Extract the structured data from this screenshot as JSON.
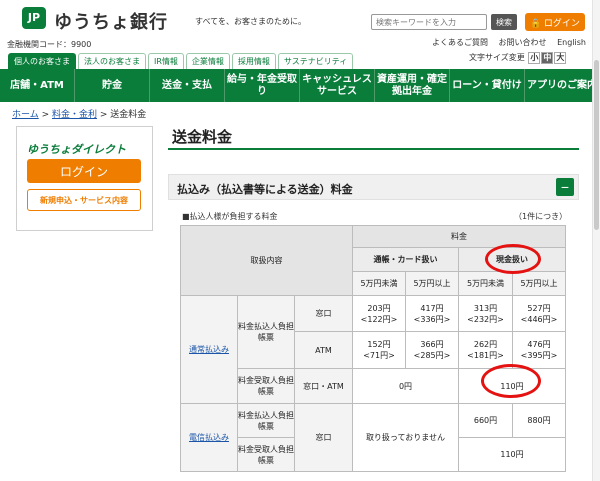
{
  "header": {
    "logo_text": "JP",
    "bank_name": "ゆうちょ銀行",
    "tagline": "すべてを、お客さまのために。",
    "search_placeholder": "検索キーワードを入力",
    "search_label": "検索",
    "login_label": "ログイン",
    "bank_code": "金融機関コード：9900",
    "utility_links": [
      "よくあるご質問",
      "お問い合わせ",
      "English"
    ],
    "font_size_label": "文字サイズ変更",
    "font_sizes": [
      "小",
      "中",
      "大"
    ]
  },
  "tabs": [
    "個人のお客さま",
    "法人のお客さま",
    "IR情報",
    "企業情報",
    "採用情報",
    "サステナビリティ"
  ],
  "main_nav": [
    "店舗・ATM",
    "貯金",
    "送金・支払",
    "給与・年金受取り",
    "キャッシュレスサービス",
    "資産運用・確定拠出年金",
    "ローン・貸付け",
    "アプリのご案内"
  ],
  "breadcrumb": [
    "ホーム",
    "料金・金利",
    "送金料金"
  ],
  "sidebar": {
    "direct_logo": "ゆうちょダイレクト",
    "login_label": "ログイン",
    "apply_label": "新規申込・サービス内容"
  },
  "page_title": "送金料金",
  "section_title": "払込み（払込書等による送金）料金",
  "table": {
    "note_left": "■払込人様が負担する料金",
    "note_right": "（1件につき）",
    "h_content": "取扱内容",
    "h_fee": "料金",
    "h_passbook": "通帳・カード扱い",
    "h_cash": "現金扱い",
    "h_under": "5万円未満",
    "h_over": "5万円以上",
    "cat_normal": "通常払込み",
    "cat_telegraph": "電信払込み",
    "payer_slip": "料金払込人負担帳票",
    "receiver_slip": "料金受取人負担帳票",
    "ch_counter": "窓口",
    "ch_atm": "ATM",
    "ch_both": "窓口・ATM",
    "counter_vals": [
      [
        "203円",
        "<122円>"
      ],
      [
        "417円",
        "<336円>"
      ],
      [
        "313円",
        "<232円>"
      ],
      [
        "527円",
        "<446円>"
      ]
    ],
    "atm_vals": [
      [
        "152円",
        "<71円>"
      ],
      [
        "366円",
        "<285円>"
      ],
      [
        "262円",
        "<181円>"
      ],
      [
        "476円",
        "<395円>"
      ]
    ],
    "recv_passbook": "0円",
    "recv_cash": "110円",
    "tel_na": "取り扱っておりません",
    "tel_under": "660円",
    "tel_over": "880円",
    "tel_recv": "110円"
  },
  "colors": {
    "brand_green": "#0a7d3b",
    "accent_orange": "#ef7d00",
    "highlight_red": "#e51212"
  }
}
